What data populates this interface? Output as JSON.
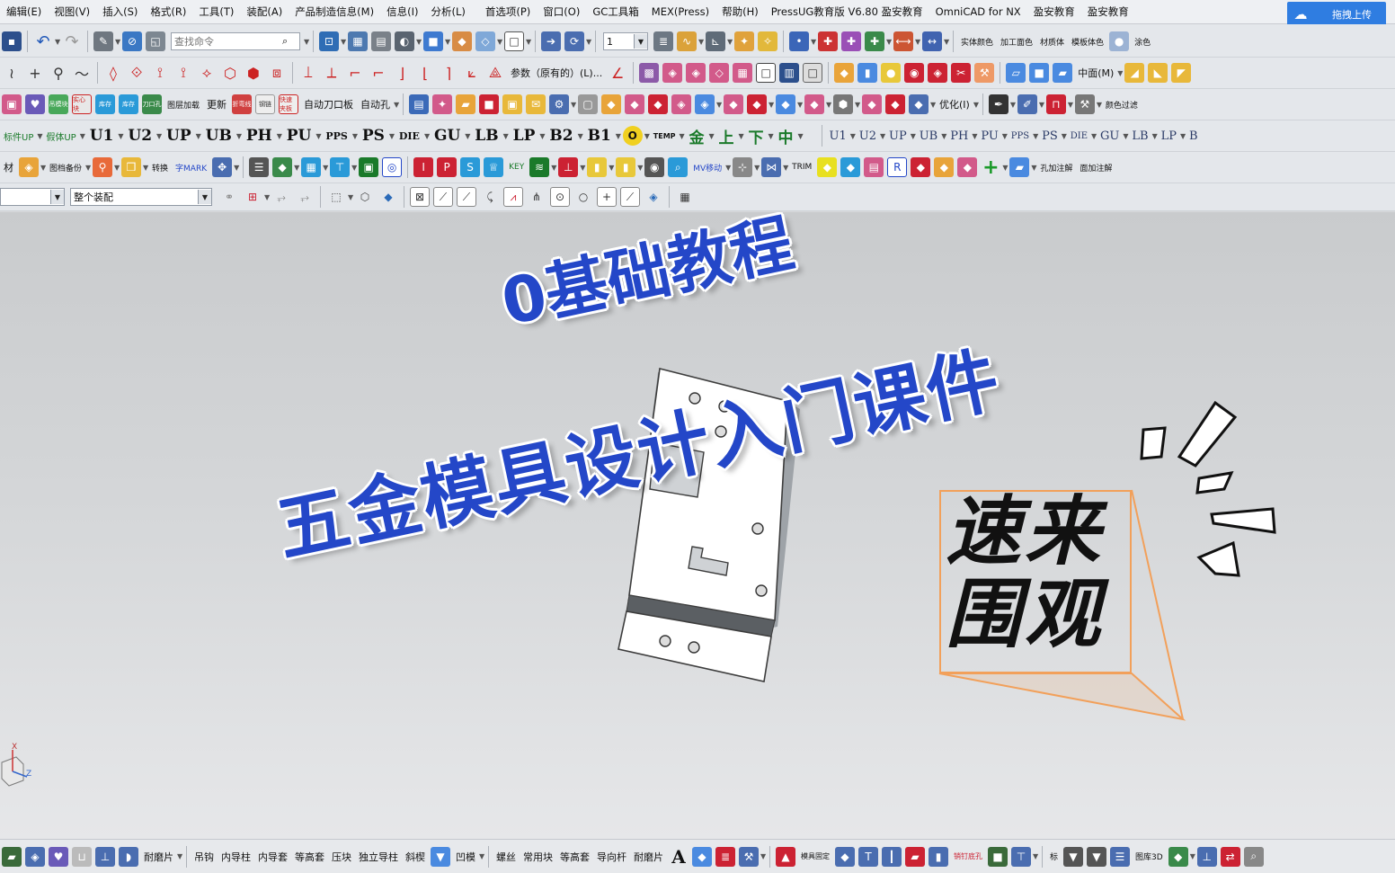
{
  "menubar": {
    "items": [
      "编辑(E)",
      "视图(V)",
      "插入(S)",
      "格式(R)",
      "工具(T)",
      "装配(A)",
      "产品制造信息(M)",
      "信息(I)",
      "分析(L)",
      "首选项(P)",
      "窗口(O)",
      "GC工具箱",
      "MEX(Press)",
      "帮助(H)",
      "PressUG教育版 V6.80 盈安教育",
      "OmniCAD for NX",
      "盈安教育",
      "盈安教育"
    ],
    "upload_label": "拖拽上传"
  },
  "toolbar": {
    "search_placeholder": "查找命令",
    "layer_value": "1",
    "param_label": "参数（原有的）(L)...",
    "mid_label": "中面(M)",
    "optimize_label": "优化(I)",
    "auto_blade_label": "自动刀口板",
    "auto_hole_label": "自动孔",
    "update_label": "更新",
    "mini_labels": [
      "吊模块",
      "实心块",
      "库存",
      "库存",
      "刀口孔",
      "图层加载",
      "折弯线",
      "钢链",
      "快速夹板"
    ],
    "std_label": "标件UP",
    "fake_label": "假体UP",
    "drawing_label": "图档备份",
    "convert_label": "转换",
    "mark_label": "字MARK",
    "key_label": "KEY",
    "mv_label": "MV移动",
    "trim_label": "TRIM",
    "plate_labels": [
      "U1",
      "U2",
      "UP",
      "UB",
      "PH",
      "PU",
      "PPS",
      "PS",
      "DIE",
      "GU",
      "LB",
      "LP",
      "B2",
      "B1"
    ],
    "temp_label": "TEMP",
    "position_labels": [
      "金",
      "上",
      "下",
      "中"
    ],
    "move_labels": [
      "U1",
      "U2",
      "UP",
      "UB",
      "PH",
      "PU",
      "PPS",
      "PS",
      "DIE",
      "GU",
      "LB",
      "LP",
      "B"
    ],
    "right_labels": [
      "实体颜色",
      "加工面色",
      "材质体",
      "模板体色",
      "涂色",
      "颜色过滤",
      "孔加注解",
      "面加注解"
    ],
    "filter_value": "",
    "assembly_value": "整个装配"
  },
  "viewport": {
    "title_line1": "0基础教程",
    "title_line2": "五金模具设计入门课件",
    "badge_line1": "速来",
    "badge_line2": "围观",
    "axis_x": "X",
    "axis_z": "Z"
  },
  "statusbar": {
    "items": [
      "耐磨片",
      "吊钩",
      "内导柱",
      "内导套",
      "等高套",
      "压块",
      "独立导柱",
      "斜楔",
      "凹模",
      "螺丝",
      "常用块",
      "等高套",
      "导向杆",
      "耐磨片",
      "模具固定",
      "销钉底孔",
      "标",
      "图库3D"
    ]
  },
  "colors": {
    "title_blue": "#2447c8",
    "badge_orange": "#f2a05a",
    "upload_blue": "#2f7de1"
  }
}
